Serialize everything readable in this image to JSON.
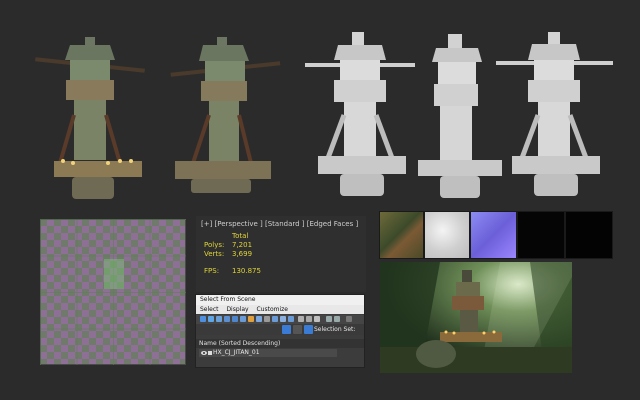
{
  "viewport": {
    "label": "[+] [Perspective ] [Standard ] [Edged Faces ]",
    "total_header": "Total",
    "polys_label": "Polys:",
    "polys_value": "7,201",
    "verts_label": "Verts:",
    "verts_value": "3,699",
    "fps_label": "FPS:",
    "fps_value": "130.875"
  },
  "dialog": {
    "title": "Select From Scene",
    "menu": [
      "Select",
      "Display",
      "Customize"
    ],
    "selection_set_label": "Selection Set:",
    "column_header": "Name (Sorted Descending)",
    "rows": [
      "HX_CJ_JITAN_01"
    ]
  },
  "colors": {
    "background": "#2b2b2b",
    "stats_yellow": "#e0d43a",
    "accent_blue": "#3a7bd5"
  },
  "icons": [
    "eye-icon",
    "object-icon"
  ]
}
